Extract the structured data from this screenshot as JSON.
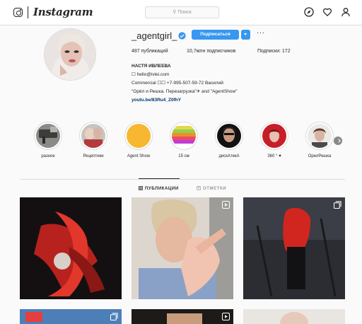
{
  "nav": {
    "brand": "Instagram",
    "search_placeholder": "Поиск",
    "icons": [
      "instagram-glyph-icon",
      "explore-compass-icon",
      "heart-icon",
      "profile-icon"
    ]
  },
  "profile": {
    "username": "_agentgirl_",
    "follow_label": "Подписаться",
    "more_label": "···",
    "stats": {
      "posts": "487 публикаций",
      "followers": "10,7млн подписчиков",
      "following": "Подписки: 172"
    },
    "bio": {
      "name": "НАСТЯ ИВЛЕЕВА",
      "email": "☐ hello@ivlei.com",
      "commercial": "Commercial ☐☐ +7-995-507-59-72 Василий",
      "shows": "\"Орёл и Решка. Перезагрузка\"✈ and \"AgentShow\"",
      "link": "youtu.be/83Ru4_Z0fhY"
    }
  },
  "stories": [
    {
      "label": "разное"
    },
    {
      "label": "Рецептики"
    },
    {
      "label": "Agent Show"
    },
    {
      "label": "15 см"
    },
    {
      "label": "дискAтекА"
    },
    {
      "label": "360 ° ♥"
    },
    {
      "label": "ОрелРешка"
    }
  ],
  "tabs": [
    {
      "label": "ПУБЛИКАЦИИ",
      "active": true
    },
    {
      "label": "ОТМЕТКИ",
      "active": false
    }
  ],
  "colors": {
    "accent": "#3897f0",
    "border": "#dbdbdb",
    "bg": "#fafafa"
  }
}
